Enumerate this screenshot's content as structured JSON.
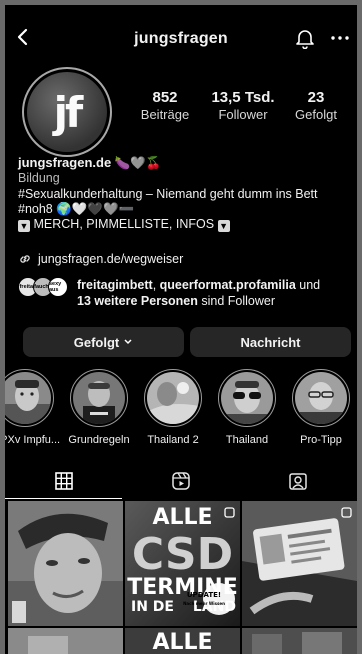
{
  "header": {
    "username": "jungsfragen",
    "icons": [
      "back-arrow-icon",
      "bell-icon",
      "more-icon"
    ]
  },
  "profile": {
    "avatar_text": "jf",
    "stats": [
      {
        "value": "852",
        "label": "Beiträge"
      },
      {
        "value": "13,5 Tsd.",
        "label": "Follower"
      },
      {
        "value": "23",
        "label": "Gefolgt"
      }
    ],
    "display_name": "jungsfragen.de",
    "name_emojis": "🍆🩶🍒",
    "category": "Bildung",
    "bio_line1": "#Sexualkunderhaltung – Niemand geht dumm ins Bett",
    "bio_line2_tag": "#noh8",
    "bio_line2_emojis": "🌍🤍🖤🩶➖",
    "bio_line3": "MERCH, PIMMELLISTE, INFOS",
    "link": "jungsfragen.de/wegweiser"
  },
  "followed_by": {
    "avatars": [
      "freitag",
      "fauche",
      "sexy aus"
    ],
    "name1": "freitagimbett",
    "name2": "queerformat.profamilia",
    "conj": "und",
    "more": "13 weitere Personen",
    "suffix": "sind Follower"
  },
  "actions": {
    "follow_label": "Gefolgt",
    "message_label": "Nachricht"
  },
  "highlights": [
    {
      "label": "MPXv Impfu..."
    },
    {
      "label": "Grundregeln"
    },
    {
      "label": "Thailand 2"
    },
    {
      "label": "Thailand"
    },
    {
      "label": "Pro-Tipp"
    }
  ],
  "tabs": [
    "grid-icon",
    "reels-icon",
    "tagged-icon"
  ],
  "posts": {
    "p2_line1": "ALLE",
    "p2_line2": "CSD",
    "p2_line3": "TERMINE",
    "p2_line4": "IN DE",
    "p2_line4b": "LAND",
    "p2_badge": "UPDATE!",
    "p2_badge_sub": "Nach mehr Wissen",
    "p5_line1": "ALLE"
  }
}
